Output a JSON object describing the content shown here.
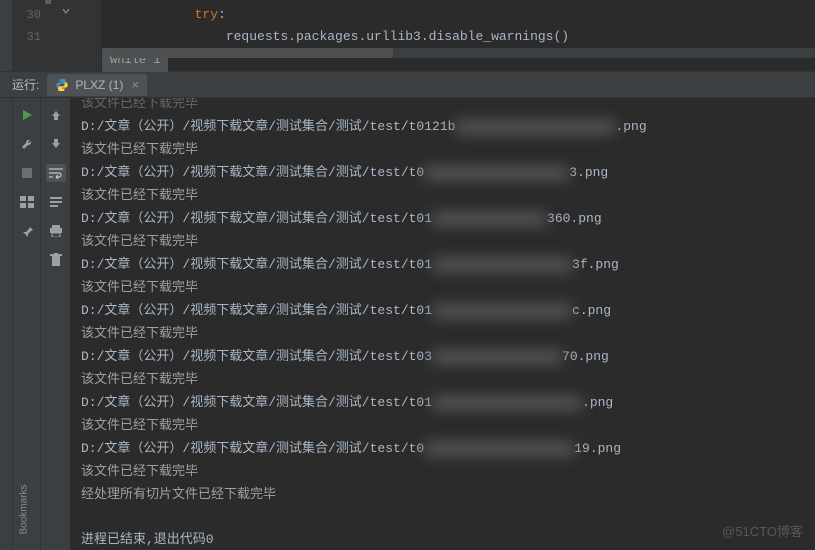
{
  "editor": {
    "line_numbers": [
      "30",
      "31"
    ],
    "code_lines": [
      {
        "indent": "            ",
        "kw": "try",
        "rest": ":"
      },
      {
        "indent": "                ",
        "text": "requests.packages.urllib3.disable_warnings()"
      }
    ],
    "hint": "while 1"
  },
  "run_panel": {
    "label": "运行:",
    "tab_name": "PLXZ (1)"
  },
  "sidebar_vertical_label": "Bookmarks",
  "console": {
    "truncated_top": "该文件已经下载完毕",
    "entries": [
      {
        "path_prefix": "D:/文章（公开）/视频下载文章/测试集合/测试/test/t0121b",
        "path_suffix": ".png",
        "blur_width": 160
      },
      {
        "path_prefix": "D:/文章（公开）/视频下载文章/测试集合/测试/test/t0",
        "path_suffix": "3.png",
        "blur_width": 145
      },
      {
        "path_prefix": "D:/文章（公开）/视频下载文章/测试集合/测试/test/t01",
        "path_suffix": "360.png",
        "blur_width": 115
      },
      {
        "path_prefix": "D:/文章（公开）/视频下载文章/测试集合/测试/test/t01",
        "path_suffix": "3f.png",
        "blur_width": 140
      },
      {
        "path_prefix": "D:/文章（公开）/视频下载文章/测试集合/测试/test/t01",
        "path_suffix": "c.png",
        "blur_width": 140
      },
      {
        "path_prefix": "D:/文章（公开）/视频下载文章/测试集合/测试/test/t03",
        "path_suffix": "70.png",
        "blur_width": 130
      },
      {
        "path_prefix": "D:/文章（公开）/视频下载文章/测试集合/测试/test/t01",
        "path_suffix": ".png",
        "blur_width": 150
      },
      {
        "path_prefix": "D:/文章（公开）/视频下载文章/测试集合/测试/test/t0",
        "path_suffix": "19.png",
        "blur_width": 150
      }
    ],
    "status_line": "该文件已经下载完毕",
    "summary_line": "经处理所有切片文件已经下载完毕",
    "exit_line": "进程已结束,退出代码0"
  },
  "watermark": "@51CTO博客"
}
